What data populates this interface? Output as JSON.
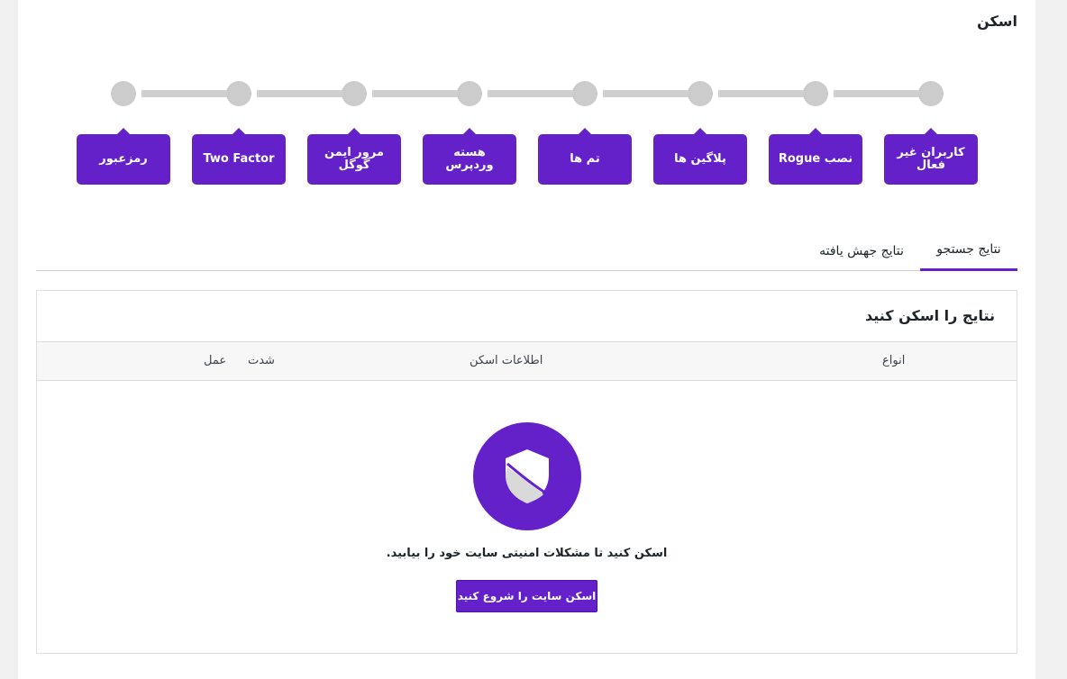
{
  "page": {
    "title": "اسکن"
  },
  "steps": [
    {
      "label": "کاربران غیر فعال"
    },
    {
      "label": "نصب Rogue"
    },
    {
      "label": "پلاگین ها"
    },
    {
      "label": "تم ها"
    },
    {
      "label": "هسته وردپرس"
    },
    {
      "label": "مرور ایمن گوگل"
    },
    {
      "label": "Two Factor"
    },
    {
      "label": "رمزعبور"
    }
  ],
  "tabs": {
    "search_results": "نتایج جستجو",
    "mutation_results": "نتایج جهش یافته"
  },
  "results": {
    "title": "نتایج را اسکن کنید",
    "columns": {
      "types": "انواع",
      "scan_info": "اطلاعات اسکن",
      "severity": "شدت",
      "action": "عمل"
    },
    "empty_message": "اسکن کنید تا مشکلات امنیتی سایت خود را بیابید.",
    "start_button": "اسکن سایت را شروع کنید"
  },
  "colors": {
    "accent": "#6521c9",
    "step_inactive": "#cccccc",
    "background": "#f0f0f1"
  },
  "icons": {
    "empty_state": "shield-icon"
  }
}
